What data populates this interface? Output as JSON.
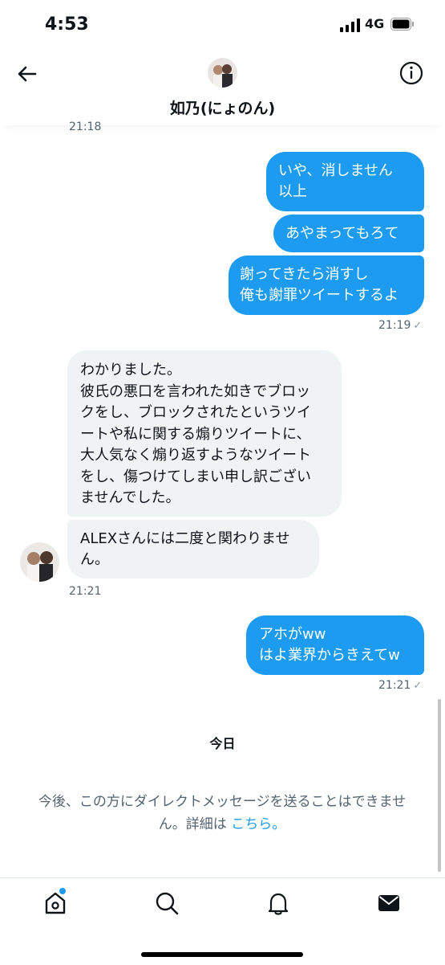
{
  "status_bar": {
    "time": "4:53",
    "network": "4G"
  },
  "header": {
    "name": "如乃(にょのん)"
  },
  "messages": {
    "top_time": "21:18",
    "out1_line1": "いや、消しません",
    "out1_line2": "以上",
    "out2": "あやまってもろて",
    "out3_line1": "謝ってきたら消すし",
    "out3_line2": "俺も謝罪ツイートするよ",
    "out_time1": "21:19",
    "in1_lines": [
      "わかりました。",
      "彼氏の悪口を言われた如きでブロッ",
      "クをし、ブロックされたというツイ",
      "ートや私に関する煽りツイートに、",
      "大人気なく煽り返すようなツイート",
      "をし、傷つけてしまい申し訳ござい",
      "ませんでした。"
    ],
    "in2_line1": "ALEXさんには二度と関わりませ",
    "in2_line2": "ん。",
    "in_time": "21:21",
    "out4_line1": "アホがww",
    "out4_line2": "はよ業界からきえてw",
    "out_time2": "21:21"
  },
  "today_label": "今日",
  "notice": {
    "line1": "今後、この方にダイレクトメッセージを送ることはできませ",
    "line2_prefix": "ん。詳細は ",
    "link": "こちら。"
  },
  "colors": {
    "accent": "#1d9bf0",
    "bubble_in": "#eff3f4"
  },
  "icons": [
    "back-arrow-icon",
    "info-icon",
    "home-icon",
    "search-icon",
    "bell-icon",
    "mail-icon"
  ]
}
